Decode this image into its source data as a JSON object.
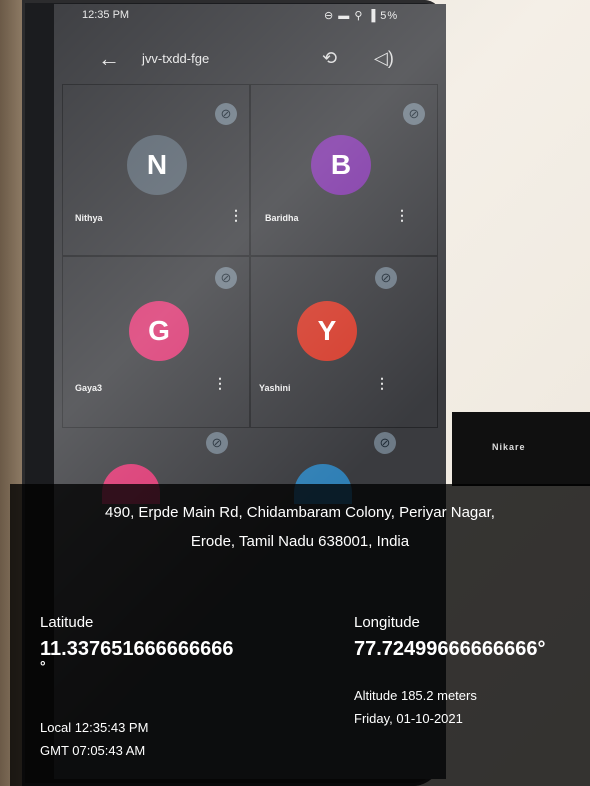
{
  "status_bar": {
    "time": "12:35 PM",
    "system": "⊖ ▬ ⚲ ▐ 5%"
  },
  "meeting": {
    "name": "jvv-txdd-fge",
    "back_icon": "arrow-left-icon",
    "switch_camera_icon": "camera-switch-icon",
    "audio_icon": "speaker-icon"
  },
  "participants": [
    {
      "initial": "N",
      "name": "Nithya",
      "color": "#5a6570"
    },
    {
      "initial": "B",
      "name": "Baridha",
      "color": "#7a2fa3"
    },
    {
      "initial": "G",
      "name": "Gaya3",
      "color": "#d9336f"
    },
    {
      "initial": "Y",
      "name": "Yashini",
      "color": "#d43a2a"
    }
  ],
  "thumbnail": {
    "label": "Nikare"
  },
  "geo": {
    "address_line1": "490, Erpde Main Rd, Chidambaram Colony, Periyar Nagar,",
    "address_line2": "Erode, Tamil Nadu 638001, India",
    "latitude_label": "Latitude",
    "latitude_value": "11.337651666666666",
    "latitude_degree": "°",
    "longitude_label": "Longitude",
    "longitude_value": "77.72499666666666°",
    "local_time": "Local 12:35:43 PM",
    "gmt_time": "GMT 07:05:43 AM",
    "altitude": "Altitude 185.2 meters",
    "date": "Friday, 01-10-2021"
  }
}
